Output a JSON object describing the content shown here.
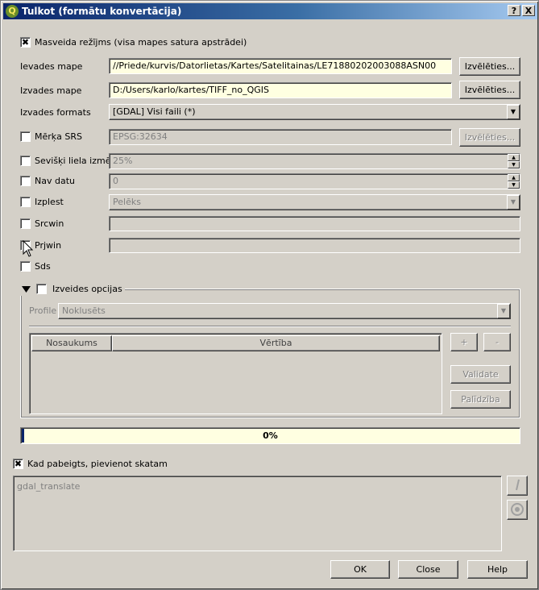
{
  "window": {
    "title": "Tulkot (formātu konvertācija)",
    "help_btn": "?",
    "close_btn": "X"
  },
  "batch": {
    "label": "Masveida režījms (visa mapes satura apstrādei)",
    "checked": true
  },
  "input_dir": {
    "label": "Ievades mape",
    "value": "//Priede/kurvis/Datorlietas/Kartes/Satelitainas/LE71880202003088ASN00",
    "button": "Izvēlēties..."
  },
  "output_dir": {
    "label": "Izvades mape",
    "value": "D:/Users/karlo/kartes/TIFF_no_QGIS",
    "button": "Izvēlēties..."
  },
  "output_format": {
    "label": "Izvades formats",
    "value": "[GDAL] Visi faili (*)"
  },
  "target_srs": {
    "label": "Mērķa SRS",
    "value": "EPSG:32634",
    "button": "Izvēlēties..."
  },
  "resize": {
    "label": "Sevišķi liela izmēr",
    "value": "25%"
  },
  "nodata": {
    "label": "Nav datu",
    "value": "0"
  },
  "expand": {
    "label": "Izplest",
    "value": "Pelēks"
  },
  "srcwin": {
    "label": "Srcwin",
    "value": ""
  },
  "prjwin": {
    "label": "Prjwin",
    "value": ""
  },
  "sds": {
    "label": "Sds"
  },
  "creation_options": {
    "label": "Izveides opcijas",
    "profile_label": "Profile",
    "profile_value": "Noklusēts",
    "columns": [
      "Nosaukums",
      "Vērtība"
    ],
    "add_btn": "+",
    "remove_btn": "-",
    "validate_btn": "Validate",
    "help_btn": "Palīdzība"
  },
  "progress": {
    "text": "0%",
    "value": 0
  },
  "load_into_canvas": {
    "label": "Kad pabeigts, pievienot skatam",
    "checked": true
  },
  "command": {
    "text": "gdal_translate"
  },
  "buttons": {
    "ok": "OK",
    "close": "Close",
    "help": "Help"
  }
}
